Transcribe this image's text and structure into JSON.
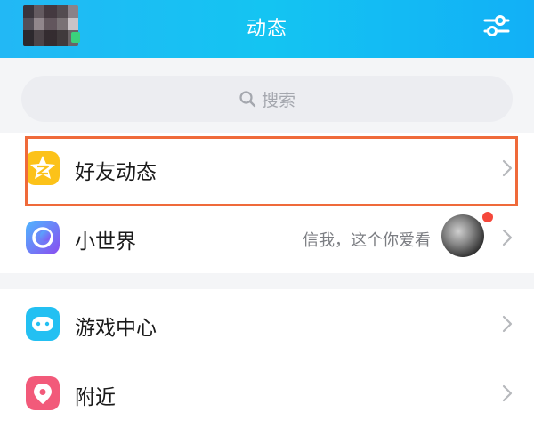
{
  "header": {
    "title": "动态",
    "avatar_icon": "avatar",
    "settings_icon": "filter-sliders-icon"
  },
  "search": {
    "placeholder": "搜索",
    "icon": "search-icon"
  },
  "menu": {
    "friends_feed": {
      "label": "好友动态",
      "icon": "qzone-star-icon",
      "color": "#fcc219"
    },
    "small_world": {
      "label": "小世界",
      "subtitle": "信我，这个你爱看",
      "icon": "small-world-icon",
      "color": "#6b5cf0",
      "badge": "red-dot"
    },
    "game_center": {
      "label": "游戏中心",
      "icon": "gamepad-icon",
      "color": "#23c0f2"
    },
    "nearby": {
      "label": "附近",
      "icon": "location-pin-icon",
      "color": "#f25a7a"
    }
  },
  "colors": {
    "header_start": "#22b8f5",
    "header_end": "#12b0f6",
    "highlight_border": "#ef6a3a",
    "badge": "#f5483b"
  }
}
